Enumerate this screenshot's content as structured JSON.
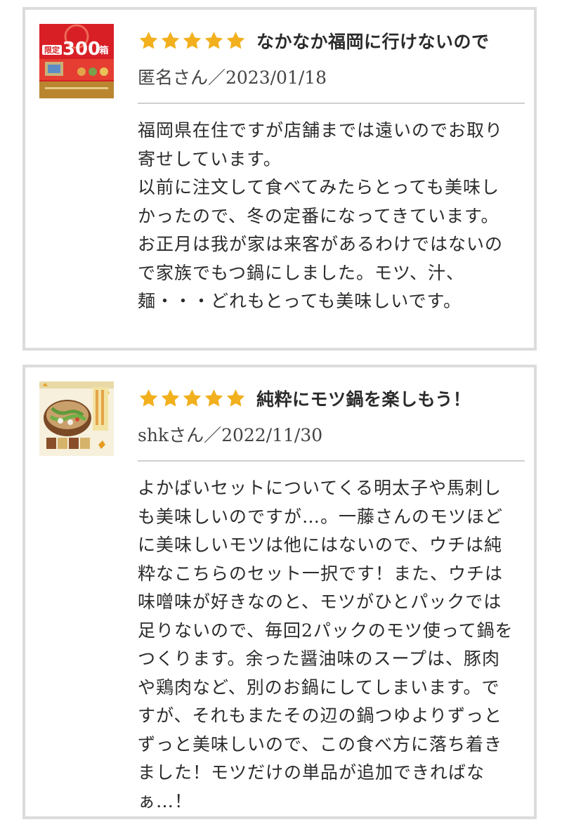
{
  "reviews": [
    {
      "rating": 5,
      "thumbnail": {
        "badge_label": "限定",
        "badge_count": "300",
        "badge_unit": "箱"
      },
      "title": "なかなか福岡に行けないので",
      "meta": "匿名さん／2023/01/18",
      "paragraphs": [
        "福岡県在住ですが店舗までは遠いのでお取り寄せしています。",
        "以前に注文して食べてみたらとっても美味しかったので、冬の定番になってきています。お正月は我が家は来客があるわけではないので家族でもつ鍋にしました。モツ、汁、麺・・・どれもとっても美味しいです。"
      ]
    },
    {
      "rating": 5,
      "thumbnail": {},
      "title": "純粋にモツ鍋を楽しもう！",
      "meta": "shkさん／2022/11/30",
      "paragraphs": [
        "よかばいセットについてくる明太子や馬刺しも美味しいのですが…。一藤さんのモツほどに美味しいモツは他にはないので、ウチは純粋なこちらのセット一択です！また、ウチは味噌味が好きなのと、モツがひとパックでは足りないので、毎回2パックのモツ使って鍋をつくります。余った醤油味のスープは、豚肉や鶏肉など、別のお鍋にしてしまいます。ですが、それもまたその辺の鍋つゆよりずっとずっと美味しいので、この食べ方に落ち着きました！モツだけの単品が追加できればなぁ…！"
      ]
    }
  ],
  "colors": {
    "star": "#f2b01e",
    "border": "#dcdcdc",
    "divider": "#cfcfcf",
    "thumb_red": "#d81f26"
  }
}
